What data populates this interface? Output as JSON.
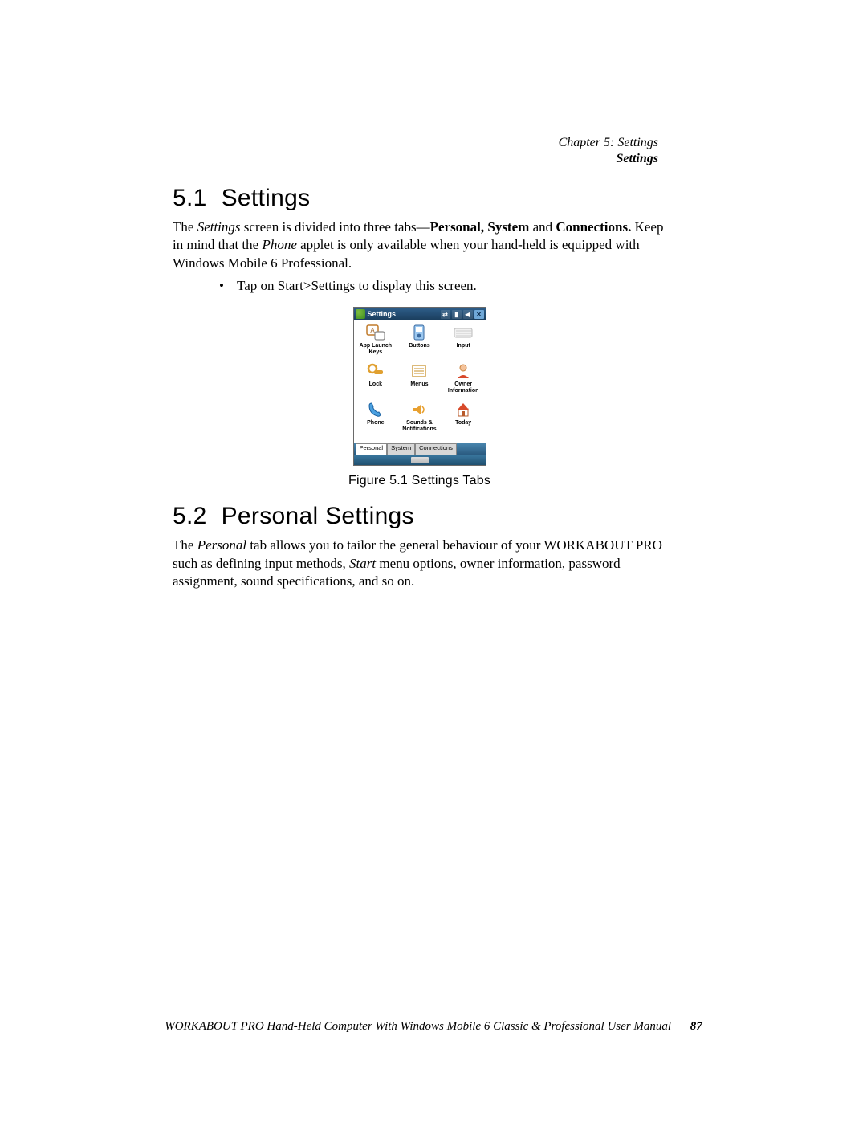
{
  "header": {
    "chapter": "Chapter 5: Settings",
    "sub": "Settings"
  },
  "section1": {
    "num": "5.1",
    "title": "Settings"
  },
  "para1": {
    "a": "The ",
    "b": "Settings",
    "c": " screen is divided into three tabs—",
    "d": "Personal, System",
    "e": " and ",
    "f": "Connections.",
    "g": " Keep in mind that the ",
    "h": "Phone",
    "i": " applet is only available when your hand-held is equipped with Windows Mobile 6 Professional."
  },
  "bullet1": {
    "a": "Tap on ",
    "b": "Start>Settings",
    "c": " to display this screen."
  },
  "figure": {
    "caption": "Figure 5.1 Settings Tabs"
  },
  "device": {
    "title": "Settings",
    "tabs": [
      "Personal",
      "System",
      "Connections"
    ],
    "apps": [
      {
        "name": "applaunch",
        "label": "App Launch Keys"
      },
      {
        "name": "buttons",
        "label": "Buttons"
      },
      {
        "name": "input",
        "label": "Input"
      },
      {
        "name": "lock",
        "label": "Lock"
      },
      {
        "name": "menus",
        "label": "Menus"
      },
      {
        "name": "owner",
        "label": "Owner Information"
      },
      {
        "name": "phone",
        "label": "Phone"
      },
      {
        "name": "sounds",
        "label": "Sounds & Notifications"
      },
      {
        "name": "today",
        "label": "Today"
      }
    ]
  },
  "section2": {
    "num": "5.2",
    "title": "Personal Settings"
  },
  "para2": {
    "a": "The ",
    "b": "Personal",
    "c": " tab allows you to tailor the general behaviour of your WORKABOUT PRO such as defining input methods, ",
    "d": "Start",
    "e": " menu options, owner information, password assignment, sound specifications, and so on."
  },
  "footer": {
    "text": "WORKABOUT PRO Hand-Held Computer With Windows Mobile 6 Classic & Professional User Manual",
    "page": "87"
  }
}
